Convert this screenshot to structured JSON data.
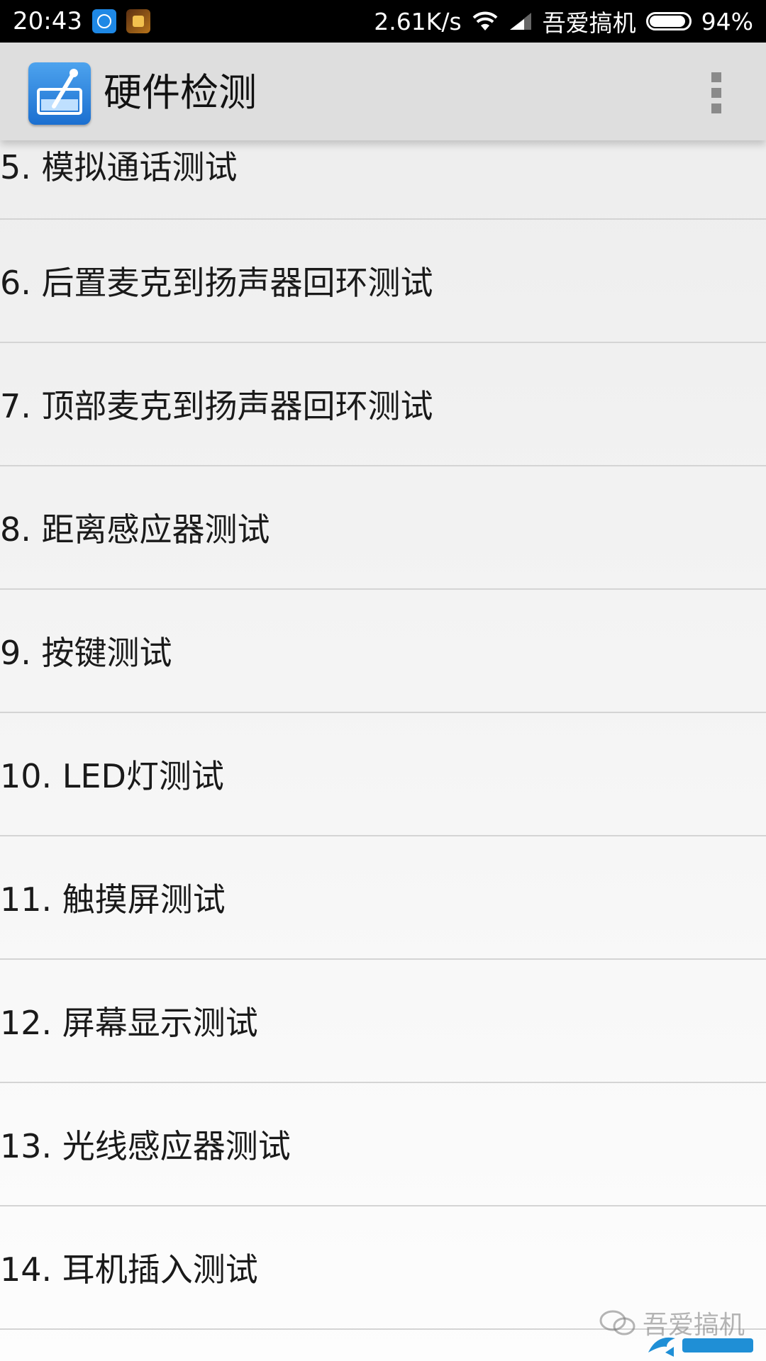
{
  "status_bar": {
    "time": "20:43",
    "net_speed": "2.61K/s",
    "carrier": "吾爱搞机",
    "battery": "94%",
    "battery_level": 0.94
  },
  "action_bar": {
    "title": "硬件检测",
    "app_icon": "test-tube-icon",
    "overflow_icon": "overflow-menu-icon"
  },
  "list": {
    "items": [
      "5. 模拟通话测试",
      "6. 后置麦克到扬声器回环测试",
      "7. 顶部麦克到扬声器回环测试",
      "8. 距离感应器测试",
      "9. 按键测试",
      "10. LED灯测试",
      "11. 触摸屏测试",
      "12. 屏幕显示测试",
      "13. 光线感应器测试",
      "14. 耳机插入测试"
    ]
  },
  "watermark": {
    "text": "吾爱搞机"
  },
  "colors": {
    "status_bar": "#000000",
    "action_bar": "#dedede",
    "app_icon": "#1b6fd0",
    "divider": "#d4d4d4"
  }
}
